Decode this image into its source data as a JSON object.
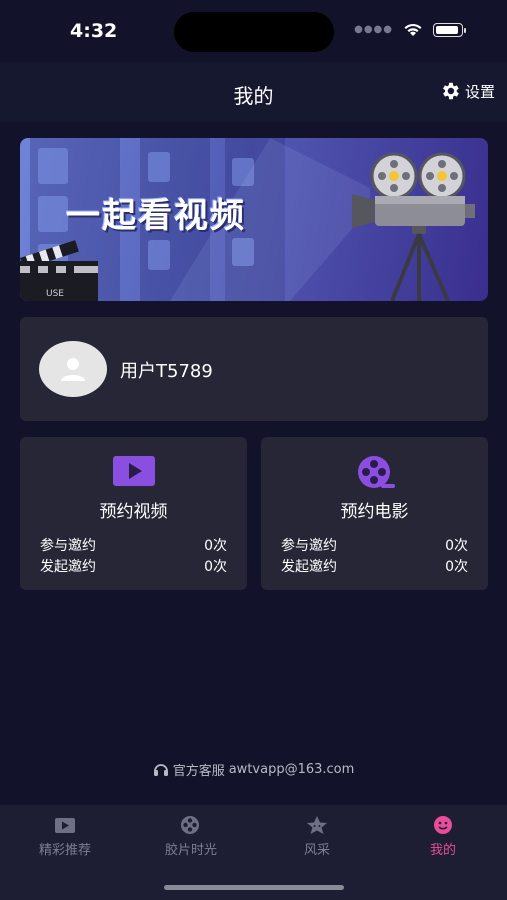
{
  "status_bar": {
    "time": "4:32"
  },
  "header": {
    "title": "我的",
    "settings_label": "设置"
  },
  "banner": {
    "title": "一起看视频",
    "clapper_text": "USE"
  },
  "user": {
    "name": "用户T5789"
  },
  "features": [
    {
      "title": "预约视频",
      "icon": "play-icon",
      "rows": [
        {
          "label": "参与邀约",
          "value": "0次"
        },
        {
          "label": "发起邀约",
          "value": "0次"
        }
      ]
    },
    {
      "title": "预约电影",
      "icon": "film-reel-icon",
      "rows": [
        {
          "label": "参与邀约",
          "value": "0次"
        },
        {
          "label": "发起邀约",
          "value": "0次"
        }
      ]
    }
  ],
  "service": {
    "label": "官方客服",
    "email": "awtvapp@163.com"
  },
  "tabs": [
    {
      "label": "精彩推荐",
      "icon": "play-icon",
      "active": false
    },
    {
      "label": "胶片时光",
      "icon": "film-reel-icon",
      "active": false
    },
    {
      "label": "风采",
      "icon": "star-icon",
      "active": false
    },
    {
      "label": "我的",
      "icon": "smile-icon",
      "active": true
    }
  ],
  "colors": {
    "background": "#12132a",
    "card": "#262636",
    "accent": "#e84c9b",
    "feature_icon": "#8a4fe0"
  }
}
